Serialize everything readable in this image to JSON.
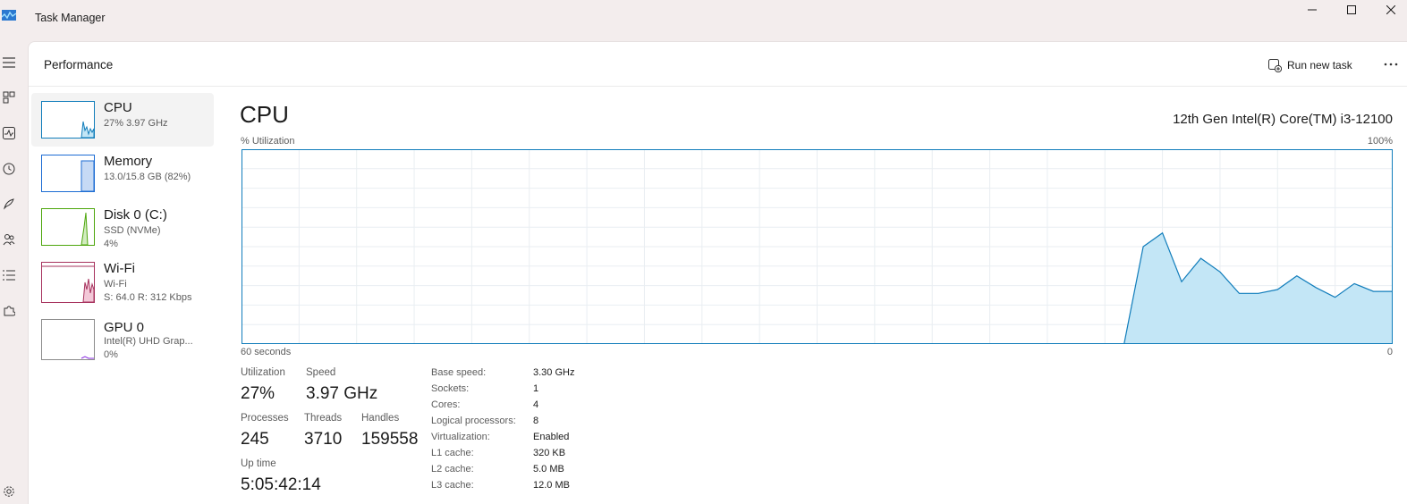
{
  "window": {
    "title": "Task Manager"
  },
  "header": {
    "page_title": "Performance",
    "run_new_task_label": "Run new task"
  },
  "sidebar": {
    "items": [
      {
        "name": "CPU",
        "line1": "27% 3.97 GHz",
        "line2": "",
        "color": "#117dbb"
      },
      {
        "name": "Memory",
        "line1": "13.0/15.8 GB (82%)",
        "line2": "",
        "color": "#1c6cd3"
      },
      {
        "name": "Disk 0 (C:)",
        "line1": "SSD (NVMe)",
        "line2": "4%",
        "color": "#4da60c"
      },
      {
        "name": "Wi-Fi",
        "line1": "Wi-Fi",
        "line2": "S: 64.0 R: 312 Kbps",
        "color": "#a7335e"
      },
      {
        "name": "GPU 0",
        "line1": "Intel(R) UHD Grap...",
        "line2": "0%",
        "color": "#8a2be2"
      }
    ]
  },
  "cpu": {
    "title": "CPU",
    "model": "12th Gen Intel(R) Core(TM) i3-12100",
    "utilization_axis_label": "% Utilization",
    "max_label": "100%",
    "time_label": "60 seconds",
    "min_label": "0",
    "stats": {
      "utilization_label": "Utilization",
      "utilization_value": "27%",
      "speed_label": "Speed",
      "speed_value": "3.97 GHz",
      "processes_label": "Processes",
      "processes_value": "245",
      "threads_label": "Threads",
      "threads_value": "3710",
      "handles_label": "Handles",
      "handles_value": "159558",
      "uptime_label": "Up time",
      "uptime_value": "5:05:42:14"
    },
    "specs": [
      {
        "key": "Base speed:",
        "value": "3.30 GHz"
      },
      {
        "key": "Sockets:",
        "value": "1"
      },
      {
        "key": "Cores:",
        "value": "4"
      },
      {
        "key": "Logical processors:",
        "value": "8"
      },
      {
        "key": "Virtualization:",
        "value": "Enabled"
      },
      {
        "key": "L1 cache:",
        "value": "320 KB"
      },
      {
        "key": "L2 cache:",
        "value": "5.0 MB"
      },
      {
        "key": "L3 cache:",
        "value": "12.0 MB"
      }
    ]
  },
  "chart_data": {
    "type": "area",
    "x": [
      60,
      59,
      58,
      57,
      56,
      55,
      54,
      53,
      52,
      51,
      50,
      49,
      48,
      47,
      46,
      45,
      44,
      43,
      42,
      41,
      40,
      39,
      38,
      37,
      36,
      35,
      34,
      33,
      32,
      31,
      30,
      29,
      28,
      27,
      26,
      25,
      24,
      23,
      22,
      21,
      20,
      19,
      18,
      17,
      16,
      15,
      14,
      13,
      12,
      11,
      10,
      9,
      8,
      7,
      6,
      5,
      4,
      3,
      2,
      1,
      0
    ],
    "series": [
      {
        "values": [
          null,
          null,
          null,
          null,
          null,
          null,
          null,
          null,
          null,
          null,
          null,
          null,
          null,
          null,
          null,
          null,
          null,
          null,
          null,
          null,
          null,
          null,
          null,
          null,
          null,
          null,
          null,
          null,
          null,
          null,
          null,
          null,
          null,
          null,
          null,
          null,
          null,
          null,
          null,
          null,
          null,
          null,
          null,
          null,
          null,
          null,
          0,
          50,
          57,
          32,
          44,
          37,
          26,
          26,
          28,
          35,
          29,
          24,
          31,
          27,
          27
        ]
      }
    ],
    "ylim": [
      0,
      100
    ],
    "xlim": [
      60,
      0
    ],
    "grid": true,
    "color": "#117dbb",
    "fill": "#c3e6f6"
  }
}
